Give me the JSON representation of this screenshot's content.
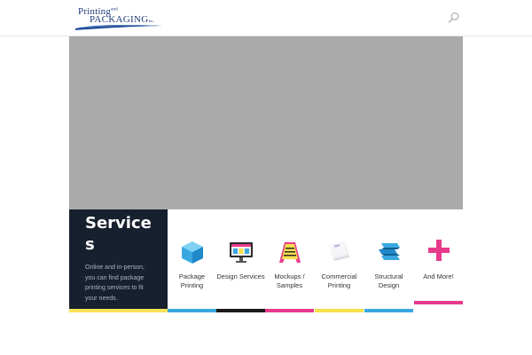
{
  "header": {
    "logo": {
      "line1": "Printing",
      "and": "and",
      "line2": "Packaging",
      "inc": "Inc."
    }
  },
  "services": {
    "title": "Services",
    "description": "Online and in-person, you can find package printing services to fit your needs."
  },
  "tiles": [
    {
      "label": "Package Printing",
      "icon": "cube-icon",
      "color": "#3aa8e0"
    },
    {
      "label": "Design Services",
      "icon": "monitor-icon",
      "color": "#1a1a1a"
    },
    {
      "label": "Mockups / Samples",
      "icon": "sandwich-sign-icon",
      "color": "#e83a8c"
    },
    {
      "label": "Commercial Printing",
      "icon": "stacked-papers-icon",
      "color": "#f4e04b"
    },
    {
      "label": "Structural Design",
      "icon": "folding-layers-icon",
      "color": "#3aa8e0"
    },
    {
      "label": "And More!",
      "icon": "plus-icon",
      "color": "#e83a8c"
    }
  ]
}
